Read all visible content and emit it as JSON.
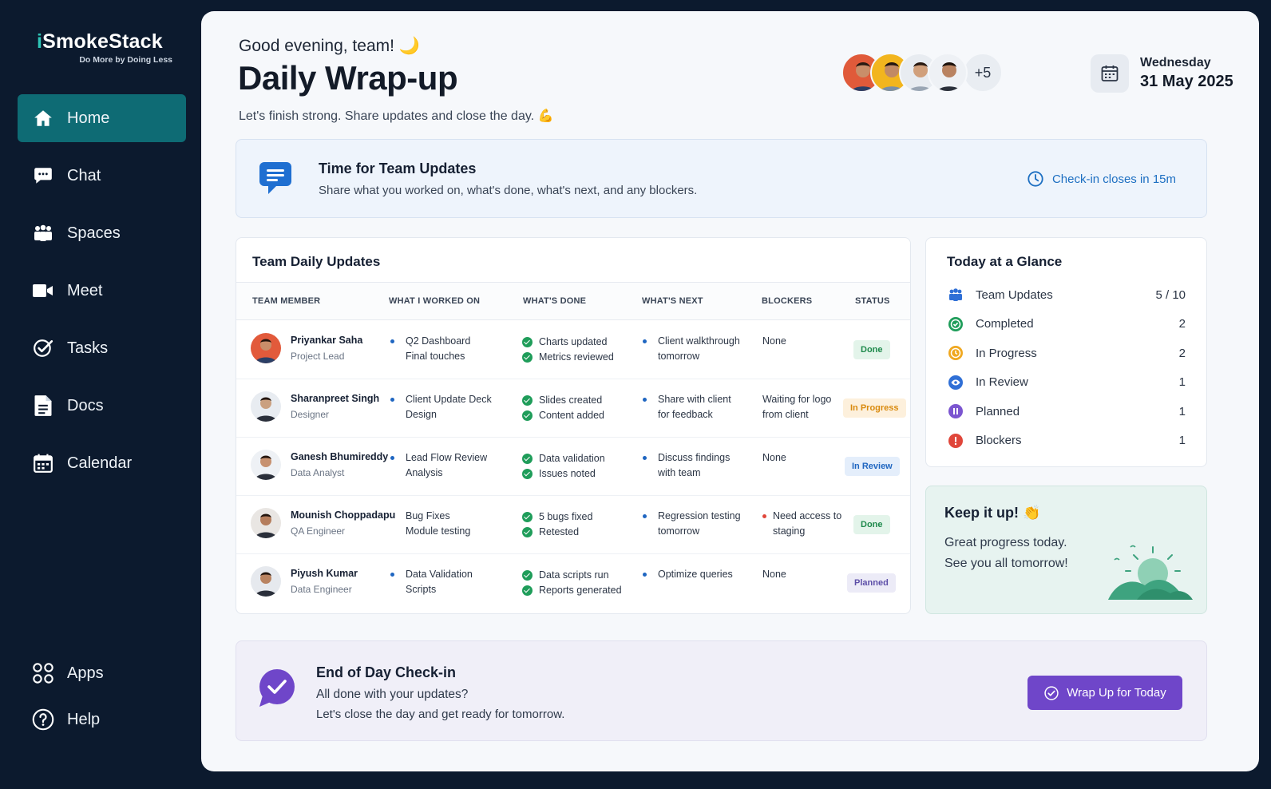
{
  "brand": {
    "name_prefix": "i",
    "name_rest": "SmokeStack",
    "tagline": "Do More by Doing Less"
  },
  "sidebar": {
    "items": [
      {
        "label": "Home",
        "icon": "home-icon",
        "active": true
      },
      {
        "label": "Chat",
        "icon": "chat-icon"
      },
      {
        "label": "Spaces",
        "icon": "spaces-icon"
      },
      {
        "label": "Meet",
        "icon": "video-icon"
      },
      {
        "label": "Tasks",
        "icon": "check-circle-icon"
      },
      {
        "label": "Docs",
        "icon": "document-icon"
      },
      {
        "label": "Calendar",
        "icon": "calendar-icon"
      }
    ],
    "bottom": [
      {
        "label": "Apps",
        "icon": "apps-grid-icon"
      },
      {
        "label": "Help",
        "icon": "help-icon"
      }
    ]
  },
  "header": {
    "greeting": "Good evening, team! 🌙",
    "title": "Daily Wrap-up",
    "subtitle": "Let's finish strong. Share updates and close the day. 💪",
    "avatars_more": "+5",
    "day": "Wednesday",
    "date": "31 May 2025"
  },
  "banner": {
    "title": "Time for Team Updates",
    "text": "Share what you worked on, what's done, what's next, and any blockers.",
    "deadline": "Check-in closes in 15m"
  },
  "updates": {
    "title": "Team Daily Updates",
    "columns": [
      "TEAM MEMBER",
      "WHAT I WORKED ON",
      "WHAT'S DONE",
      "WHAT'S NEXT",
      "BLOCKERS",
      "STATUS"
    ],
    "rows": [
      {
        "name": "Priyankar Saha",
        "role": "Project Lead",
        "worked": [
          "Q2 Dashboard",
          "Final touches"
        ],
        "done": [
          "Charts updated",
          "Metrics reviewed"
        ],
        "next": [
          "Client walkthrough",
          "tomorrow"
        ],
        "blockers": [
          "None"
        ],
        "status": "Done"
      },
      {
        "name": "Sharanpreet Singh",
        "role": "Designer",
        "worked": [
          "Client Update Deck",
          "Design"
        ],
        "done": [
          "Slides created",
          "Content added"
        ],
        "next": [
          "Share with client",
          "for feedback"
        ],
        "blockers": [
          "Waiting for logo",
          "from client"
        ],
        "status": "In Progress"
      },
      {
        "name": "Ganesh Bhumireddy",
        "role": "Data Analyst",
        "worked": [
          "Lead Flow Review",
          "Analysis"
        ],
        "done": [
          "Data validation",
          "Issues noted"
        ],
        "next": [
          "Discuss findings",
          "with team"
        ],
        "blockers": [
          "None"
        ],
        "status": "In Review"
      },
      {
        "name": "Mounish Choppadapu",
        "role": "QA Engineer",
        "worked": [
          "Bug Fixes",
          "Module testing"
        ],
        "done": [
          "5 bugs fixed",
          "Retested"
        ],
        "next": [
          "Regression testing",
          "tomorrow"
        ],
        "blockers": [
          "Need access to",
          "staging"
        ],
        "status": "Done"
      },
      {
        "name": "Piyush Kumar",
        "role": "Data Engineer",
        "worked": [
          "Data Validation",
          "Scripts"
        ],
        "done": [
          "Data scripts run",
          "Reports generated"
        ],
        "next": [
          "Optimize queries"
        ],
        "blockers": [
          "None"
        ],
        "status": "Planned"
      }
    ]
  },
  "glance": {
    "title": "Today at a Glance",
    "items": [
      {
        "label": "Team Updates",
        "value": "5 / 10",
        "icon": "team-icon",
        "color": "#2f6fd6"
      },
      {
        "label": "Completed",
        "value": "2",
        "icon": "check-icon",
        "color": "#1f9d5a"
      },
      {
        "label": "In Progress",
        "value": "2",
        "icon": "clock-icon",
        "color": "#f0a820"
      },
      {
        "label": "In Review",
        "value": "1",
        "icon": "eye-icon",
        "color": "#2f6fd6"
      },
      {
        "label": "Planned",
        "value": "1",
        "icon": "pause-icon",
        "color": "#7b55d0"
      },
      {
        "label": "Blockers",
        "value": "1",
        "icon": "alert-icon",
        "color": "#e0463a"
      }
    ]
  },
  "keep": {
    "title": "Keep it up! 👏",
    "line1": "Great progress today.",
    "line2": "See you all tomorrow!"
  },
  "checkin": {
    "title": "End of Day Check-in",
    "line1": "All done with your updates?",
    "line2": "Let's close the day and get ready for tomorrow.",
    "button": "Wrap Up for Today"
  },
  "colors": {
    "sidebar_bg": "#0c1a2e",
    "active_nav": "#0e6b74",
    "accent_blue": "#1d6fc2",
    "button_purple": "#6f46c9"
  }
}
